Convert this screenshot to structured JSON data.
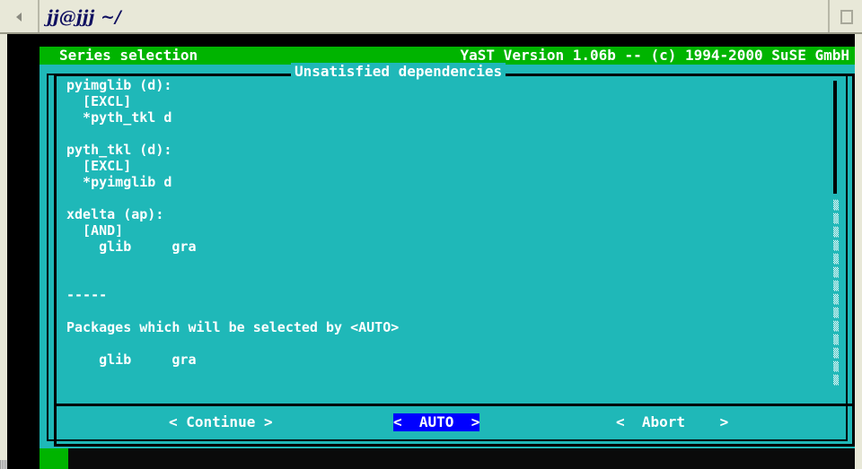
{
  "window": {
    "title": "jj@jjj ~/"
  },
  "status_bar": {
    "left": "Series selection",
    "right": "YaST Version 1.06b -- (c) 1994-2000 SuSE GmbH"
  },
  "dialog": {
    "title": "Unsatisfied dependencies",
    "lines": [
      "pyimglib (d):",
      "  [EXCL]",
      "  *pyth_tkl d",
      "",
      "pyth_tkl (d):",
      "  [EXCL]",
      "  *pyimglib d",
      "",
      "xdelta (ap):",
      "  [AND]",
      "    glib     gra",
      "",
      "",
      "-----",
      "",
      "Packages which will be selected by <AUTO>",
      "",
      "    glib     gra"
    ]
  },
  "buttons": {
    "continue": "< Continue >",
    "auto": "<  AUTO  >",
    "abort": "<  Abort    >"
  },
  "colors": {
    "dialog_bg": "#1fb8b8",
    "status_bg": "#00b400",
    "active_button": "#0000ff"
  },
  "icons": {
    "window_menu": "triangle-left-icon",
    "window_maximize": "maximize-icon",
    "scrollbar": "scroll-dots-icon"
  }
}
